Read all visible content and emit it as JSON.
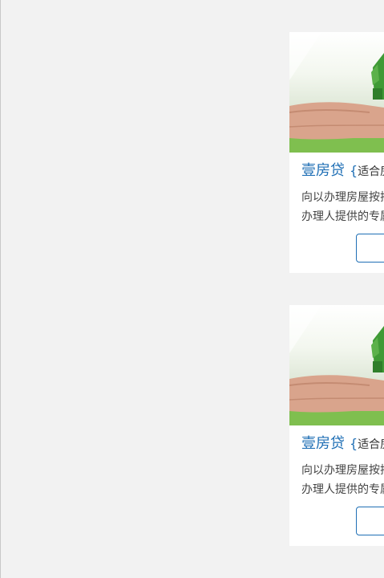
{
  "cards": [
    {
      "image_icon": "hands-holding-green-house-image",
      "title": "壹房贷",
      "title_brace": "{",
      "title_sub": "适合房",
      "desc_line1": "向以办理房屋按揭",
      "desc_line2": "办理人提供的专属",
      "button_label": ""
    },
    {
      "image_icon": "hands-holding-green-house-image",
      "title": "壹房贷",
      "title_brace": "{",
      "title_sub": "适合房",
      "desc_line1": "向以办理房屋按揭",
      "desc_line2": "办理人提供的专属",
      "button_label": ""
    }
  ],
  "colors": {
    "page_bg": "#f2f2f2",
    "card_bg": "#ffffff",
    "accent_blue": "#1f6fb5",
    "body_text": "#444444",
    "grass_green": "#79b84e"
  }
}
